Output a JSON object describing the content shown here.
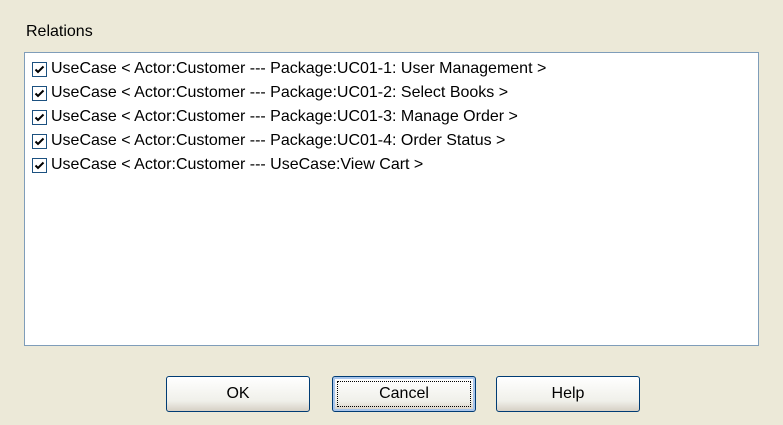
{
  "group": {
    "title": "Relations"
  },
  "relations": [
    {
      "label": "UseCase < Actor:Customer --- Package:UC01-1: User Management >",
      "checked": true
    },
    {
      "label": "UseCase < Actor:Customer --- Package:UC01-2: Select Books >",
      "checked": true
    },
    {
      "label": "UseCase < Actor:Customer --- Package:UC01-3: Manage Order >",
      "checked": true
    },
    {
      "label": "UseCase < Actor:Customer --- Package:UC01-4: Order Status >",
      "checked": true
    },
    {
      "label": "UseCase < Actor:Customer --- UseCase:View Cart >",
      "checked": true
    }
  ],
  "buttons": {
    "ok": "OK",
    "cancel": "Cancel",
    "help": "Help"
  },
  "colors": {
    "dialog_bg": "#ece9d8",
    "list_border": "#7f9db9",
    "checkbox_border": "#1c5180",
    "button_border": "#003c74"
  }
}
